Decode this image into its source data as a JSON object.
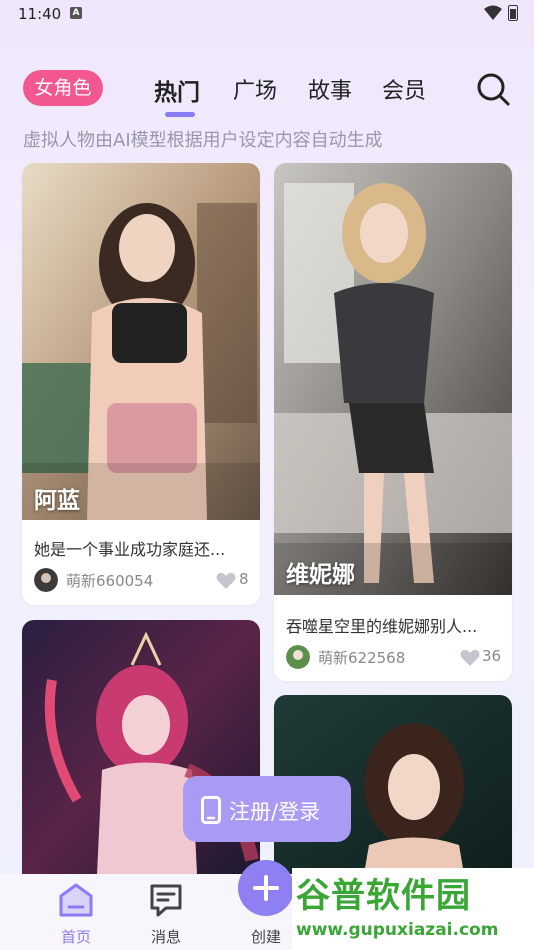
{
  "status_bar": {
    "time": "11:40",
    "icons": [
      "a-notification-icon",
      "wifi-icon",
      "battery-icon"
    ]
  },
  "header": {
    "category_pill": "女角色",
    "tabs": [
      {
        "label": "热门",
        "active": true
      },
      {
        "label": "广场",
        "active": false
      },
      {
        "label": "故事",
        "active": false
      },
      {
        "label": "会员",
        "active": false
      }
    ],
    "search_icon": "search-icon",
    "subtitle": "虚拟人物由AI模型根据用户设定内容自动生成"
  },
  "cards": [
    {
      "name": "阿蓝",
      "description": "她是一个事业成功家庭还...",
      "author": "萌新660054",
      "likes": "8"
    },
    {
      "name": "维妮娜",
      "description": "吞噬星空里的维妮娜别人...",
      "author": "萌新622568",
      "likes": "36"
    },
    {
      "name": "",
      "description": "",
      "author": "",
      "likes": ""
    },
    {
      "name": "",
      "description": "",
      "author": "",
      "likes": ""
    }
  ],
  "register_button": {
    "label": "注册/登录",
    "icon": "phone-icon"
  },
  "bottom_nav": [
    {
      "label": "首页",
      "icon": "home-icon",
      "active": true
    },
    {
      "label": "消息",
      "icon": "message-icon",
      "active": false
    },
    {
      "label": "创建",
      "icon": "plus-icon",
      "active": false
    }
  ],
  "watermark": {
    "title": "谷普软件园",
    "url": "www.gupuxiazai.com"
  },
  "colors": {
    "accent": "#8a7cf2",
    "pill": "#f2588f",
    "watermark": "#3aa636"
  }
}
